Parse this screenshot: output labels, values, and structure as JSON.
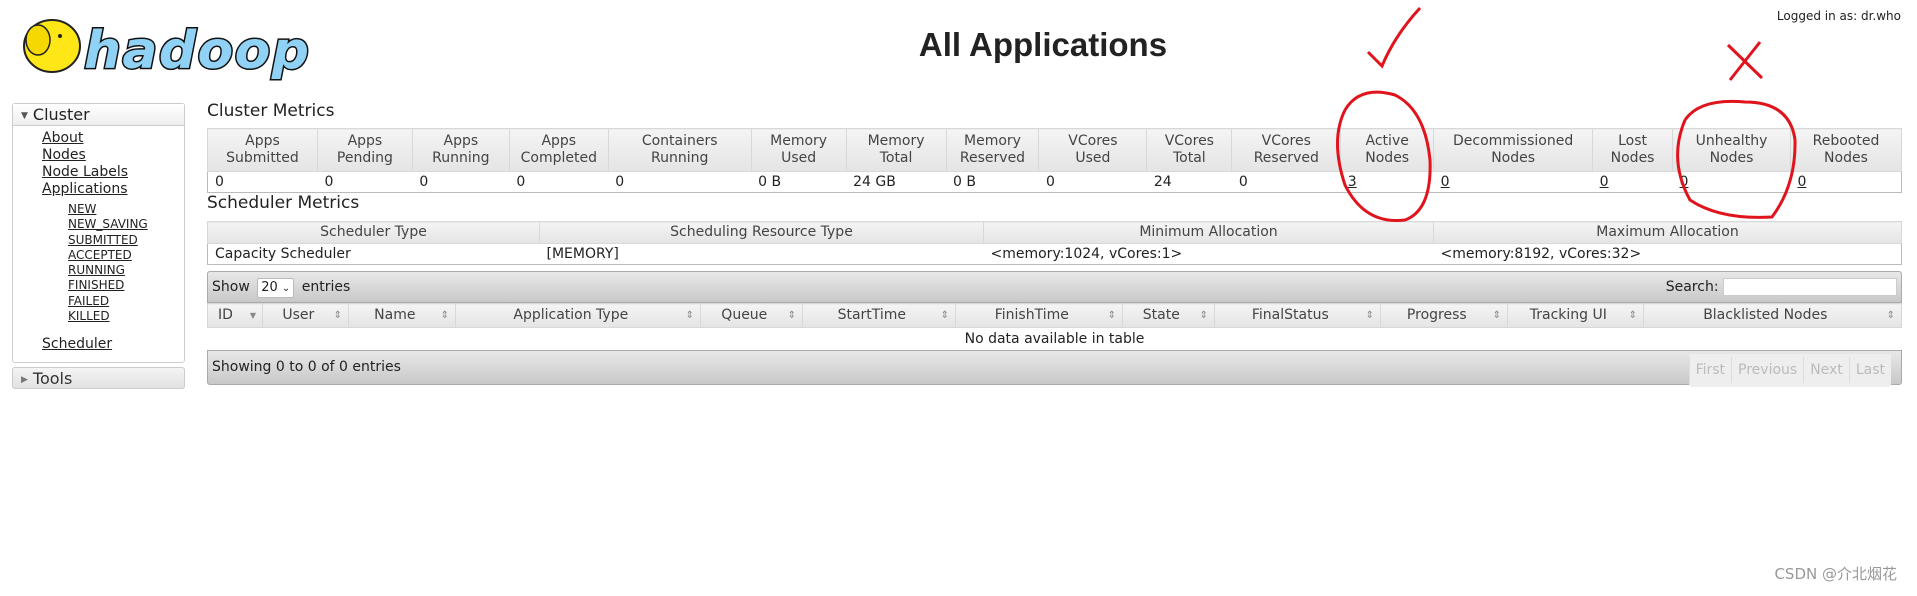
{
  "header": {
    "logo_text": "hadoop",
    "title": "All Applications",
    "logged_in": "Logged in as: dr.who"
  },
  "sidebar": {
    "cluster_label": "Cluster",
    "links": [
      "About",
      "Nodes",
      "Node Labels",
      "Applications"
    ],
    "app_states": [
      "NEW",
      "NEW_SAVING",
      "SUBMITTED",
      "ACCEPTED",
      "RUNNING",
      "FINISHED",
      "FAILED",
      "KILLED"
    ],
    "scheduler": "Scheduler",
    "tools_label": "Tools"
  },
  "cluster_metrics": {
    "title": "Cluster Metrics",
    "headers": [
      [
        "Apps",
        "Submitted"
      ],
      [
        "Apps",
        "Pending"
      ],
      [
        "Apps",
        "Running"
      ],
      [
        "Apps",
        "Completed"
      ],
      [
        "Containers",
        "Running"
      ],
      [
        "Memory",
        "Used"
      ],
      [
        "Memory",
        "Total"
      ],
      [
        "Memory",
        "Reserved"
      ],
      [
        "VCores",
        "Used"
      ],
      [
        "VCores",
        "Total"
      ],
      [
        "VCores",
        "Reserved"
      ],
      [
        "Active",
        "Nodes"
      ],
      [
        "Decommissioned",
        "Nodes"
      ],
      [
        "Lost",
        "Nodes"
      ],
      [
        "Unhealthy",
        "Nodes"
      ],
      [
        "Rebooted",
        "Nodes"
      ]
    ],
    "values": [
      "0",
      "0",
      "0",
      "0",
      "0",
      "0 B",
      "24 GB",
      "0 B",
      "0",
      "24",
      "0",
      "3",
      "0",
      "0",
      "0",
      "0"
    ]
  },
  "scheduler_metrics": {
    "title": "Scheduler Metrics",
    "headers": [
      "Scheduler Type",
      "Scheduling Resource Type",
      "Minimum Allocation",
      "Maximum Allocation"
    ],
    "values": [
      "Capacity Scheduler",
      "[MEMORY]",
      "<memory:1024, vCores:1>",
      "<memory:8192, vCores:32>"
    ]
  },
  "apps_table": {
    "show": "Show",
    "page_size": "20",
    "entries": "entries",
    "search_label": "Search:",
    "search_value": "",
    "columns": [
      "ID",
      "User",
      "Name",
      "Application Type",
      "Queue",
      "StartTime",
      "FinishTime",
      "State",
      "FinalStatus",
      "Progress",
      "Tracking UI",
      "Blacklisted Nodes"
    ],
    "empty": "No data available in table",
    "info": "Showing 0 to 0 of 0 entries",
    "pager": [
      "First",
      "Previous",
      "Next",
      "Last"
    ]
  },
  "annotations": {
    "check_color": "#e0141c",
    "cross_color": "#e0141c"
  },
  "watermark": "CSDN @介北烟花"
}
